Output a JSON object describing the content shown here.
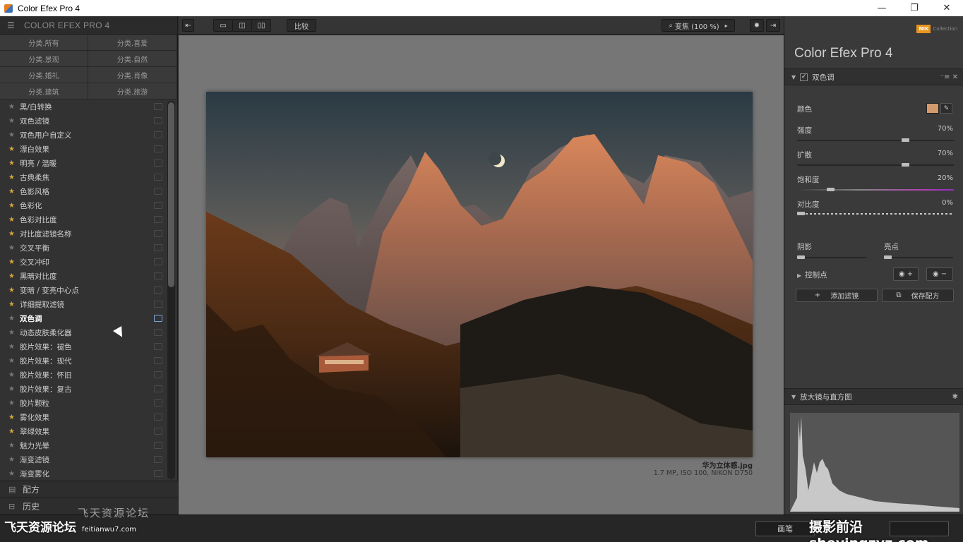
{
  "window": {
    "title": "Color Efex Pro 4",
    "controls": [
      "—",
      "❐",
      "✕"
    ]
  },
  "left_panel": {
    "title": "COLOR EFEX PRO 4",
    "categories": [
      "分类.所有",
      "分类.喜爱",
      "分类.景观",
      "分类.自然",
      "分类.婚礼",
      "分类.肖像",
      "分类.建筑",
      "分类.旅游"
    ],
    "filters": [
      {
        "label": "黑/白转换",
        "fav": false
      },
      {
        "label": "双色滤镜",
        "fav": false
      },
      {
        "label": "双色用户自定义",
        "fav": false
      },
      {
        "label": "漂白效果",
        "fav": true
      },
      {
        "label": "明亮 / 温暖",
        "fav": true
      },
      {
        "label": "古典柔焦",
        "fav": true
      },
      {
        "label": "色影风格",
        "fav": true
      },
      {
        "label": "色彩化",
        "fav": true
      },
      {
        "label": "色彩对比度",
        "fav": true
      },
      {
        "label": "对比度滤镜名称",
        "fav": true
      },
      {
        "label": "交叉平衡",
        "fav": false
      },
      {
        "label": "交叉冲印",
        "fav": true
      },
      {
        "label": "黑暗对比度",
        "fav": true
      },
      {
        "label": "变暗 / 变亮中心点",
        "fav": true
      },
      {
        "label": "详细提取滤镜",
        "fav": true
      },
      {
        "label": "双色调",
        "fav": false,
        "active": true
      },
      {
        "label": "动态皮肤柔化器",
        "fav": false
      },
      {
        "label": "胶片效果：褪色",
        "fav": false
      },
      {
        "label": "胶片效果：现代",
        "fav": false
      },
      {
        "label": "胶片效果：怀旧",
        "fav": false
      },
      {
        "label": "胶片效果：复古",
        "fav": false
      },
      {
        "label": "胶片颗粒",
        "fav": false
      },
      {
        "label": "雾化效果",
        "fav": true
      },
      {
        "label": "翠绿效果",
        "fav": true
      },
      {
        "label": "魅力光晕",
        "fav": false
      },
      {
        "label": "渐变滤镜",
        "fav": false
      },
      {
        "label": "渐变雾化",
        "fav": false
      }
    ],
    "bottom": [
      {
        "icon": "recipes-icon",
        "label": "配方"
      },
      {
        "icon": "history-icon",
        "label": "历史"
      }
    ]
  },
  "toolbar": {
    "compare_label": "比较",
    "zoom_label": "变焦 (100 %)"
  },
  "image": {
    "filename": "华为立体感.jpg",
    "meta": "1.7 MP, ISO 100, NIKON D750"
  },
  "right_panel": {
    "brand": "NIK",
    "brand_sub": "Collection",
    "product": "Color Efex Pro 4",
    "filter_section": {
      "title": "双色调",
      "tools": "⁻≡ ✕",
      "color_label": "颜色",
      "color_value": "#d39b6c",
      "sliders": [
        {
          "label": "强度",
          "value": "70%"
        },
        {
          "label": "扩散",
          "value": "70%"
        },
        {
          "label": "饱和度",
          "value": "20%"
        },
        {
          "label": "对比度",
          "value": "0%"
        }
      ],
      "shadows_label": "阴影",
      "highlights_label": "亮点",
      "control_points_label": "控制点",
      "add_filter_label": "添加滤镜",
      "save_recipe_label": "保存配方"
    },
    "loupe_section": {
      "title": "放大镜与直方图"
    }
  },
  "bottom_bar": {
    "brush_label": "画笔"
  },
  "watermarks": {
    "left": "飞天资源论坛",
    "left_small": "feitianwu7.com",
    "center": "飞天资源论坛",
    "right": "摄影前沿sheyingzyz.com"
  },
  "levels": {
    "strength": 0.7,
    "diffusion": 0.7,
    "saturation": 0.2,
    "contrast": 0.0,
    "shadows": 0.0,
    "highlights": 0.0
  }
}
